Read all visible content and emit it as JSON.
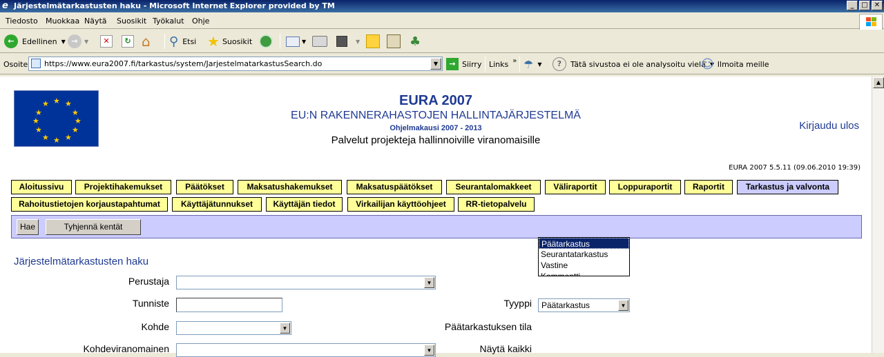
{
  "window": {
    "title": "Järjestelmätarkastusten haku - Microsoft Internet Explorer provided by TM"
  },
  "menu": [
    "Tiedosto",
    "Muokkaa",
    "Näytä",
    "Suosikit",
    "Työkalut",
    "Ohje"
  ],
  "toolbar": {
    "back_label": "Edellinen",
    "search_label": "Etsi",
    "favorites_label": "Suosikit"
  },
  "addressbar": {
    "label": "Osoite",
    "url": "https://www.eura2007.fi/tarkastus/system/JarjestelmatarkastusSearch.do",
    "go_label": "Siirry",
    "links_label": "Links",
    "analysis_text": "Tätä sivustoa ei ole analysoitu vielä",
    "report_label": "Ilmoita meille"
  },
  "header": {
    "title": "EURA 2007",
    "subtitle": "EU:N RAKENNERAHASTOJEN HALLINTAJÄRJESTELMÄ",
    "period": "Ohjelmakausi 2007 - 2013",
    "services": "Palvelut projekteja hallinnoiville viranomaisille",
    "logout": "Kirjaudu ulos",
    "version": "EURA 2007 5.5.11 (09.06.2010 19:39)"
  },
  "nav": {
    "row1": [
      "Aloitussivu",
      "Projektihakemukset",
      "Päätökset",
      "Maksatushakemukset",
      "Maksatuspäätökset",
      "Seurantalomakkeet",
      "Väliraportit",
      "Loppuraportit",
      "Raportit",
      "Tarkastus ja valvonta"
    ],
    "row2": [
      "Rahoitustietojen korjaustapahtumat",
      "Käyttäjätunnukset",
      "Käyttäjän tiedot",
      "Virkailijan käyttöohjeet",
      "RR-tietopalvelu"
    ],
    "active": "Tarkastus ja valvonta"
  },
  "actions": {
    "search": "Hae",
    "clear": "Tyhjennä kentät"
  },
  "form": {
    "title": "Järjestelmätarkastusten haku",
    "perustaja_label": "Perustaja",
    "tunniste_label": "Tunniste",
    "kohde_label": "Kohde",
    "kohdeviranomainen_label": "Kohdeviranomainen",
    "tyyppi_label": "Tyyppi",
    "tyyppi_value": "Päätarkastus",
    "paatarkastuksen_tila_label": "Päätarkastuksen tila",
    "nayta_kaikki_label": "Näytä kaikki",
    "tyyppi_options": [
      "Päätarkastus",
      "Seurantatarkastus",
      "Vastine",
      "Kommentti"
    ]
  }
}
